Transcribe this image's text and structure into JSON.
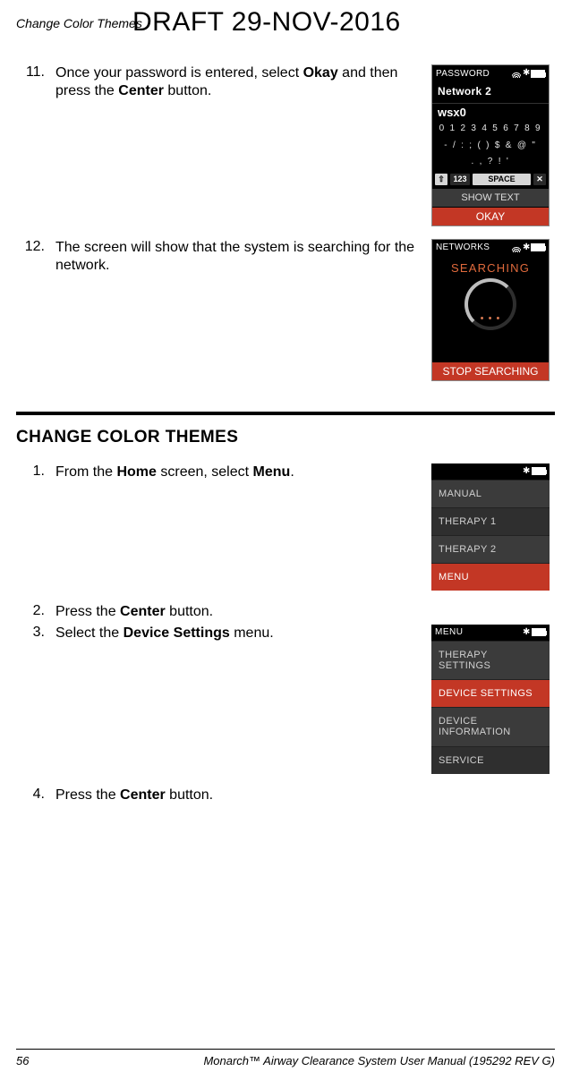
{
  "header": {
    "breadcrumb": "Change Color Themes",
    "draft": "DRAFT 29-NOV-2016"
  },
  "steps_a": [
    {
      "num": "11.",
      "parts": [
        "Once your password is entered, select ",
        "Okay",
        " and then press the ",
        "Center",
        " button."
      ]
    },
    {
      "num": "12.",
      "parts": [
        "The screen will show that the system is searching for the network."
      ]
    }
  ],
  "screen_password": {
    "title": "PASSWORD",
    "network": "Network 2",
    "field": "wsx0",
    "row1": "0 1 2 3 4 5 6 7 8 9",
    "row2": "- / : ; ( ) $ & @ \"",
    "row3": ". , ? ! '",
    "shift": "⇧",
    "numkey": "123",
    "space": "SPACE",
    "close": "✕",
    "show": "SHOW TEXT",
    "okay": "OKAY"
  },
  "screen_searching": {
    "title": "NETWORKS",
    "label": "SEARCHING",
    "dots": "• • •",
    "stop": "STOP SEARCHING"
  },
  "section_title": "CHANGE COLOR THEMES",
  "steps_b": [
    {
      "num": "1.",
      "parts": [
        "From the ",
        "Home",
        " screen, select ",
        "Menu",
        "."
      ]
    },
    {
      "num": "2.",
      "parts": [
        "Press the ",
        "Center",
        " button."
      ]
    },
    {
      "num": "3.",
      "parts": [
        "Select the ",
        "Device Settings",
        " menu."
      ]
    },
    {
      "num": "4.",
      "parts": [
        "Press the ",
        "Center",
        " button."
      ]
    }
  ],
  "screen_home": {
    "items": [
      "MANUAL",
      "THERAPY 1",
      "THERAPY 2",
      "MENU"
    ]
  },
  "screen_menu": {
    "title": "MENU",
    "items": [
      "THERAPY SETTINGS",
      "DEVICE SETTINGS",
      "DEVICE INFORMATION",
      "SERVICE"
    ]
  },
  "footer": {
    "page": "56",
    "doc": "Monarch™ Airway Clearance System User Manual (195292 REV G)"
  }
}
